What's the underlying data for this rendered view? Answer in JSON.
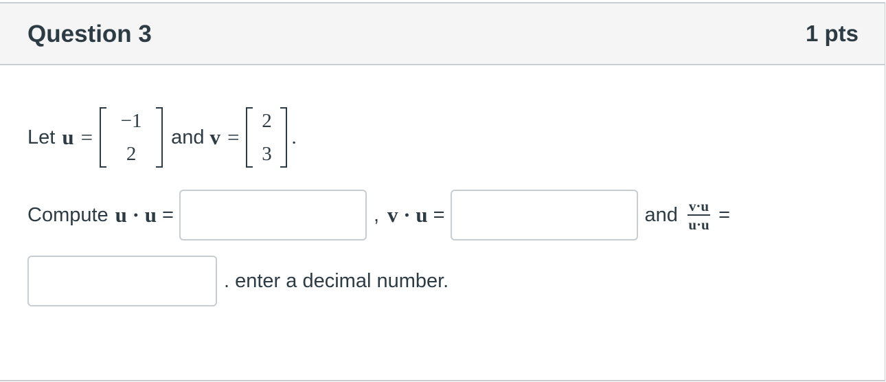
{
  "question": {
    "title": "Question 3",
    "points": "1 pts"
  },
  "statement": {
    "let": "Let",
    "u_symbol": "u",
    "equals": "=",
    "u_vector": [
      "−1",
      "2"
    ],
    "and": "and",
    "v_symbol": "v",
    "v_vector": [
      "2",
      "3"
    ],
    "period": "."
  },
  "compute": {
    "compute_label": "Compute",
    "uu_expr": "u · u",
    "eq_plain": "=",
    "comma": ",",
    "vu_expr": "v · u",
    "and": "and",
    "frac_numerator": "v·u",
    "frac_denominator": "u·u",
    "suffix": ". enter a decimal number."
  },
  "inputs": {
    "uu_value": "",
    "vu_value": "",
    "ratio_value": ""
  }
}
